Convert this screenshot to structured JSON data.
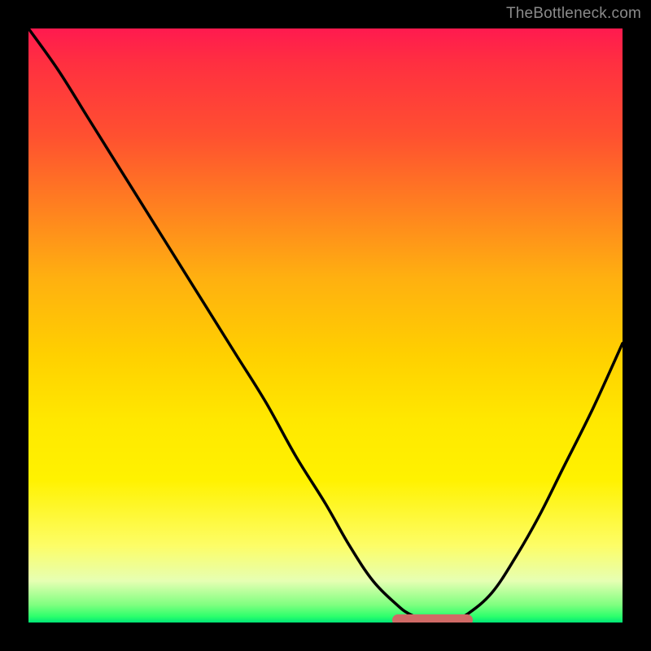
{
  "watermark": "TheBottleneck.com",
  "colors": {
    "background": "#000000",
    "curve": "#000000",
    "marker": "#d06a66"
  },
  "chart_data": {
    "type": "line",
    "title": "",
    "xlabel": "",
    "ylabel": "",
    "xlim": [
      0,
      100
    ],
    "ylim": [
      0,
      100
    ],
    "grid": false,
    "annotations": [],
    "series": [
      {
        "name": "curve",
        "x": [
          0,
          5,
          10,
          15,
          20,
          25,
          30,
          35,
          40,
          45,
          50,
          54,
          58,
          62,
          64,
          66,
          68,
          70,
          72,
          74,
          78,
          82,
          86,
          90,
          95,
          100
        ],
        "y": [
          100,
          93,
          85,
          77,
          69,
          61,
          53,
          45,
          37,
          28,
          20,
          13,
          7,
          3,
          1.5,
          0.7,
          0.3,
          0.3,
          0.7,
          1.5,
          5,
          11,
          18,
          26,
          36,
          47
        ]
      }
    ],
    "markers": [
      {
        "name": "highlight-segment",
        "x_start": 62,
        "x_end": 74,
        "y": 0.4
      }
    ]
  }
}
